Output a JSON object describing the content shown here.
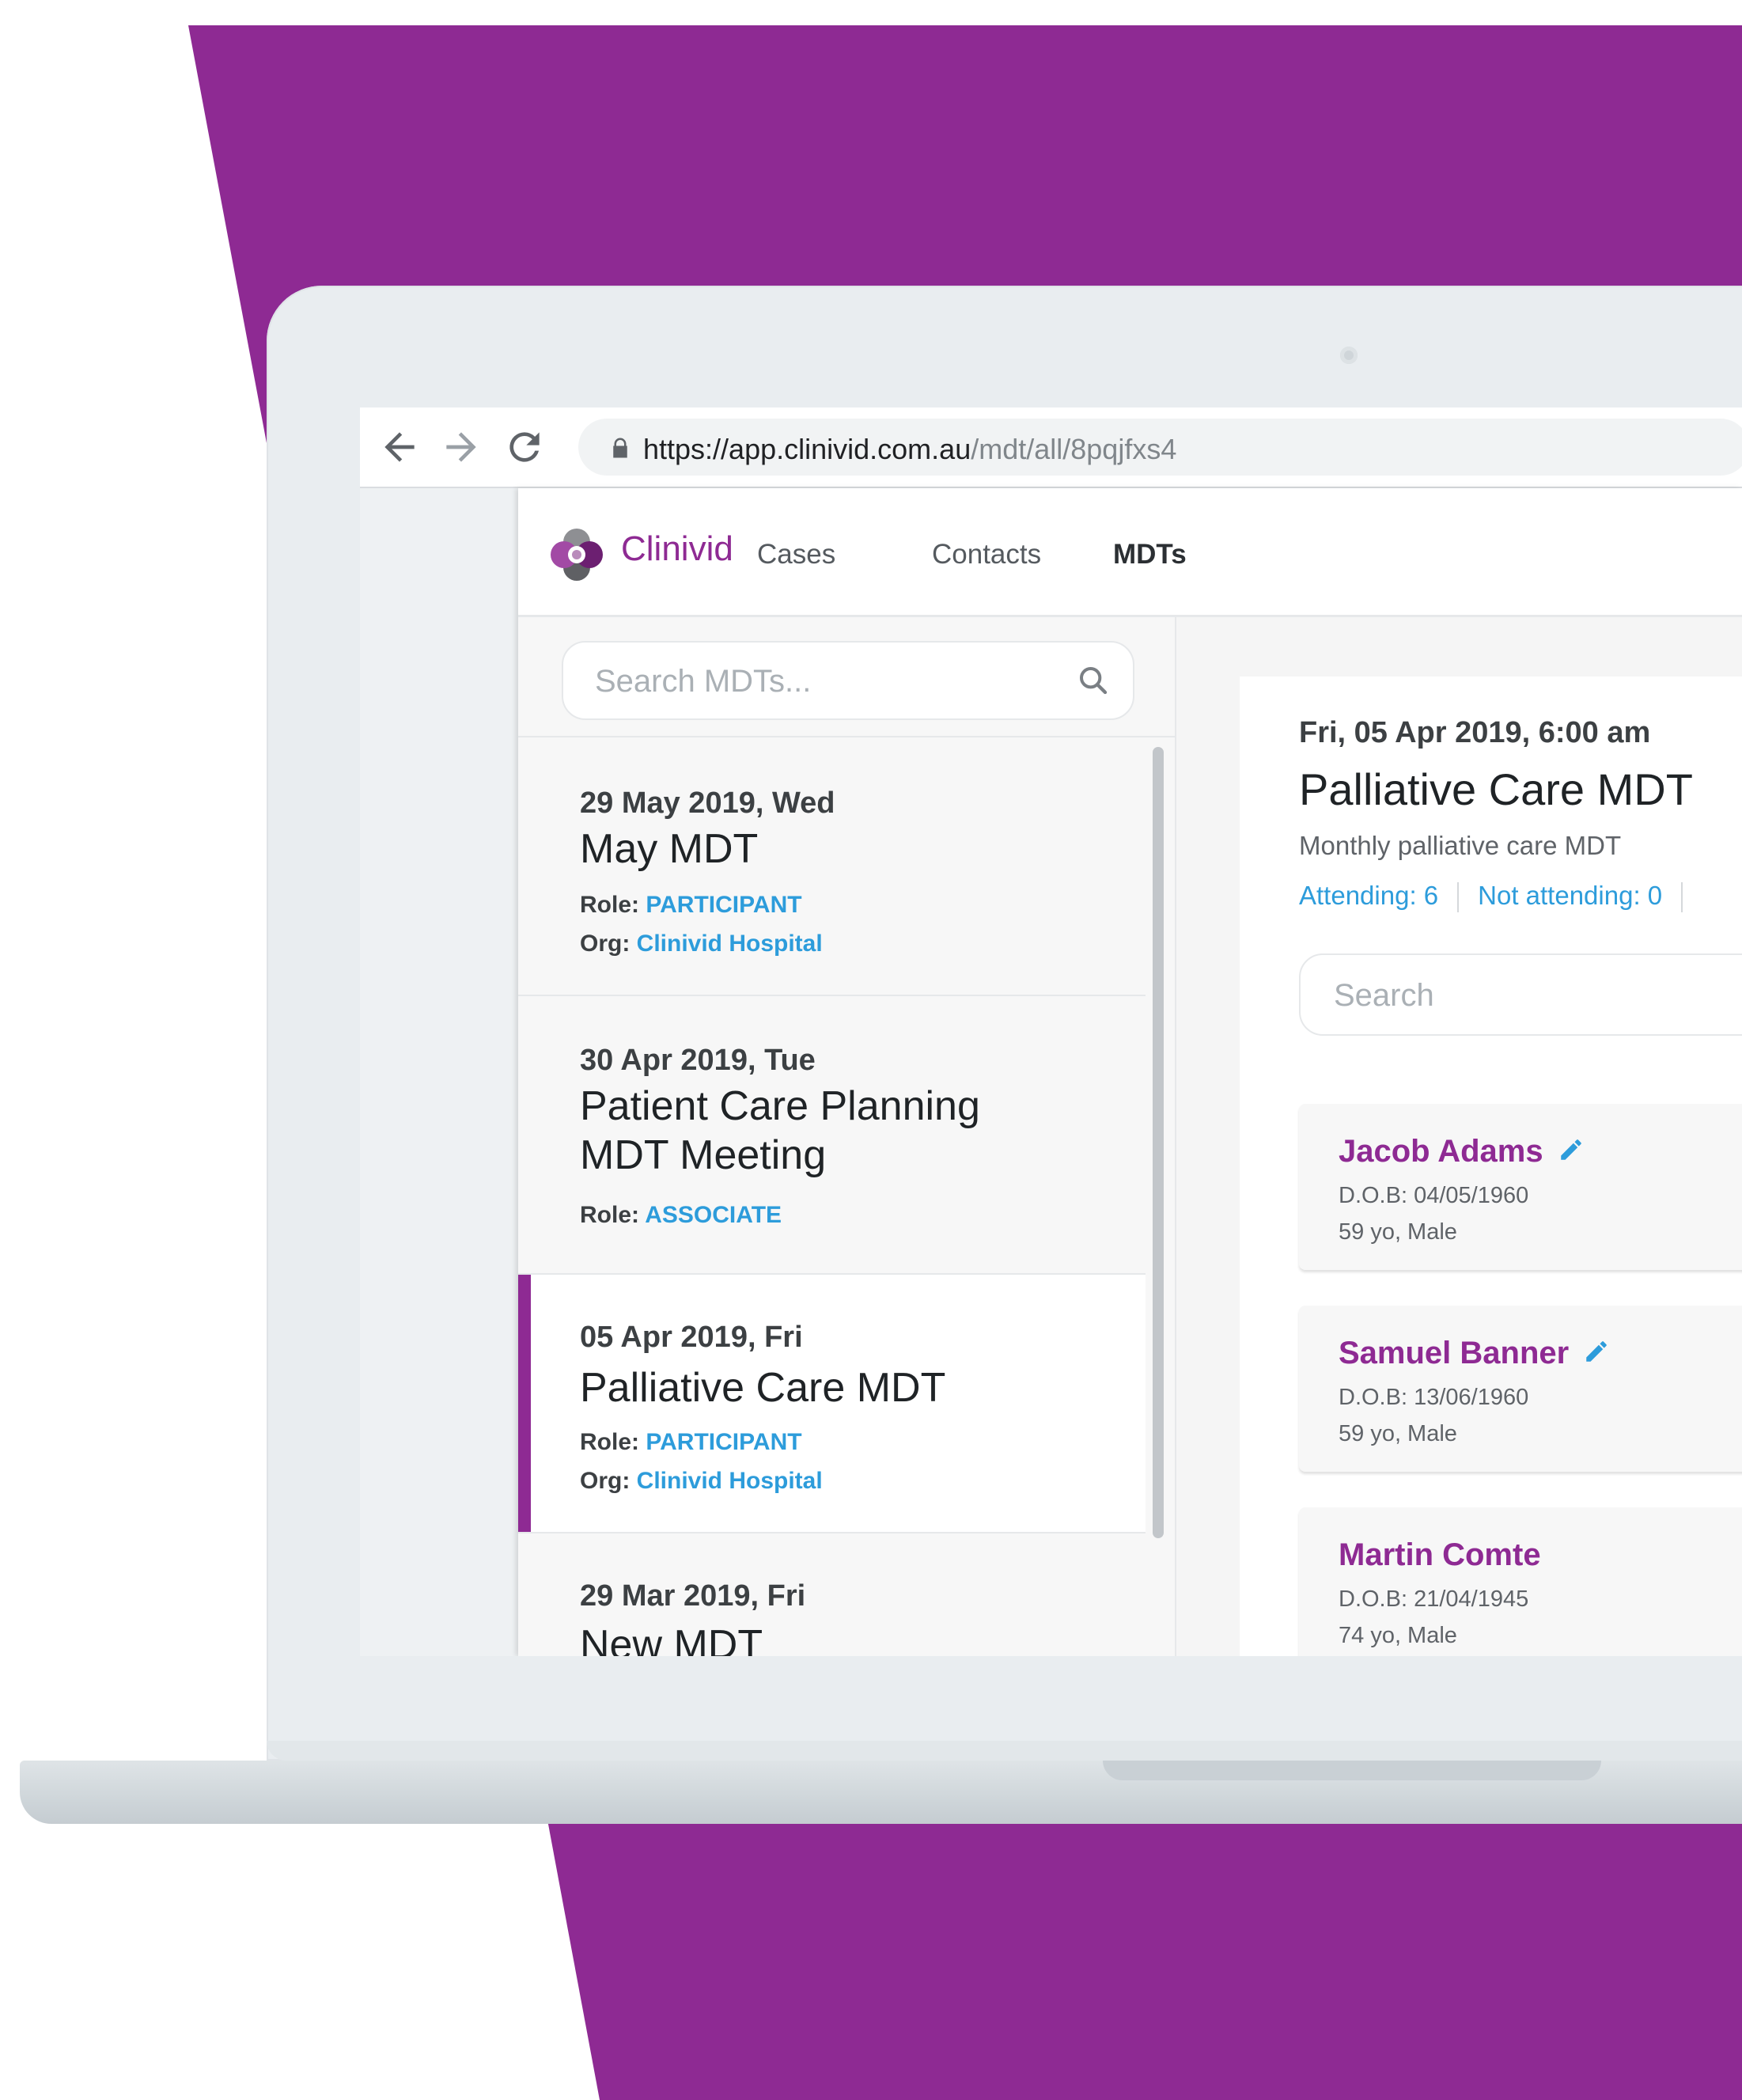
{
  "colors": {
    "brand_purple": "#8e2a93",
    "link_blue": "#2d9cdb"
  },
  "browser": {
    "url_host": "https://app.clinivid.com.au",
    "url_path": "/mdt/all/8pqjfxs4",
    "back_icon": "arrow-left-icon",
    "forward_icon": "arrow-right-icon",
    "reload_icon": "reload-icon",
    "lock_icon": "lock-icon"
  },
  "app": {
    "brand": "Clinivid",
    "nav": [
      "Cases",
      "Contacts",
      "MDTs"
    ],
    "active_nav": "MDTs"
  },
  "list": {
    "search_placeholder": "Search MDTs...",
    "items": [
      {
        "date": "29 May 2019, Wed",
        "title": "May MDT",
        "role_label": "Role:",
        "role": "PARTICIPANT",
        "org_label": "Org:",
        "org": "Clinivid Hospital"
      },
      {
        "date": "30 Apr 2019, Tue",
        "title_line1": "Patient Care Planning",
        "title_line2": "MDT Meeting",
        "role_label": "Role:",
        "role": "ASSOCIATE"
      },
      {
        "date": "05 Apr 2019, Fri",
        "title": "Palliative Care MDT",
        "role_label": "Role:",
        "role": "PARTICIPANT",
        "org_label": "Org:",
        "org": "Clinivid Hospital",
        "selected": true
      },
      {
        "date": "29 Mar 2019, Fri",
        "title": "New MDT"
      }
    ]
  },
  "detail": {
    "datetime": "Fri, 05 Apr 2019, 6:00 am",
    "title": "Palliative Care MDT",
    "description": "Monthly palliative care MDT",
    "attending": "Attending: 6",
    "not_attending": "Not attending: 0",
    "search_placeholder": "Search",
    "patients": [
      {
        "name": "Jacob  Adams",
        "dob": "D.O.B: 04/05/1960",
        "age": "59 yo, Male",
        "editable": true
      },
      {
        "name": "Samuel Banner",
        "dob": "D.O.B: 13/06/1960",
        "age": "59 yo, Male",
        "editable": true
      },
      {
        "name": "Martin Comte",
        "dob": "D.O.B: 21/04/1945",
        "age": "74 yo, Male",
        "editable": false
      }
    ]
  }
}
